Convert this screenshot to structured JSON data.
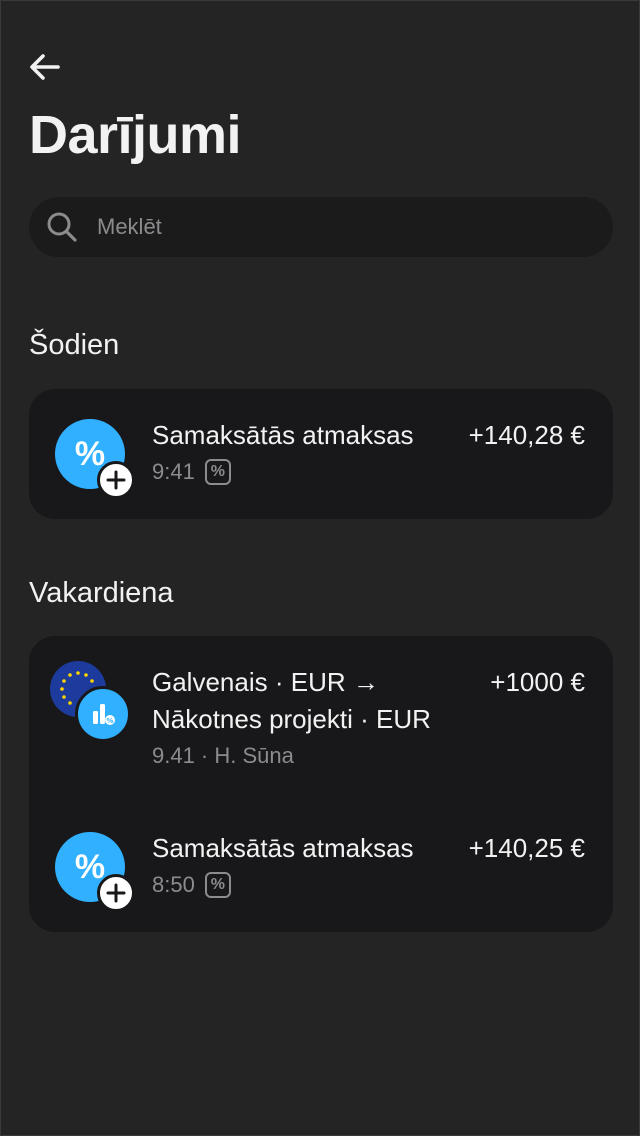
{
  "header": {
    "title": "Darījumi"
  },
  "search": {
    "placeholder": "Meklēt"
  },
  "sections": [
    {
      "title": "Šodien",
      "items": [
        {
          "title": "Samaksātās atmaksas",
          "amount": "+140,28 €",
          "time": "9:41",
          "tag": "%"
        }
      ]
    },
    {
      "title": "Vakardiena",
      "items": [
        {
          "title_line1": "Galvenais · EUR →",
          "title_line2": "Nākotnes projekti · EUR",
          "amount": "+1000 €",
          "subtitle": "9.41 · H. Sūna"
        },
        {
          "title": "Samaksātās atmaksas",
          "amount": "+140,25 €",
          "time": "8:50",
          "tag": "%"
        }
      ]
    }
  ],
  "icons": {
    "back": "arrow-left-icon",
    "search": "search-icon",
    "cashback": "percent-icon",
    "add_badge": "plus-icon",
    "eu_flag": "eu-flag-icon",
    "savings": "chart-bars-icon"
  },
  "colors": {
    "background": "#242424",
    "card": "#18181a",
    "accent": "#30b0ff",
    "muted_text": "#8c8c8e"
  }
}
